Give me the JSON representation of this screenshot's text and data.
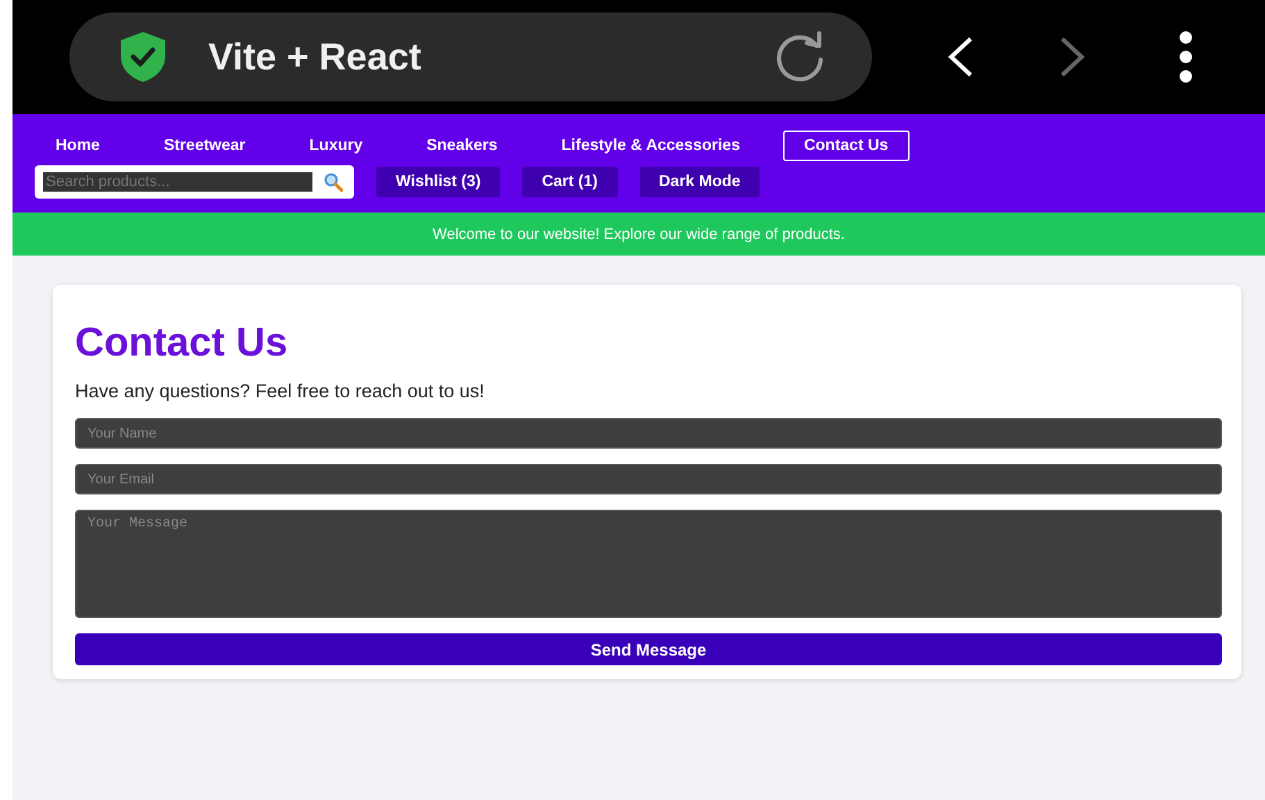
{
  "browser": {
    "title": "Vite + React",
    "back_disabled": false,
    "forward_disabled": true
  },
  "nav": {
    "links": [
      {
        "label": "Home",
        "selected": false
      },
      {
        "label": "Streetwear",
        "selected": false
      },
      {
        "label": "Luxury",
        "selected": false
      },
      {
        "label": "Sneakers",
        "selected": false
      },
      {
        "label": "Lifestyle & Accessories",
        "selected": false
      },
      {
        "label": "Contact Us",
        "selected": true
      }
    ],
    "search": {
      "placeholder": "Search products..."
    },
    "buttons": [
      "Wishlist (3)",
      "Cart (1)",
      "Dark Mode"
    ]
  },
  "banner": "Welcome to our website! Explore our wide range of products.",
  "contact": {
    "title": "Contact Us",
    "intro": "Have any questions? Feel free to reach out to us!",
    "fields": [
      {
        "kind": "input",
        "placeholder": "Your Name"
      },
      {
        "kind": "input",
        "placeholder": "Your Email"
      },
      {
        "kind": "textarea",
        "placeholder": "Your Message"
      }
    ],
    "submit": "Send Message"
  }
}
